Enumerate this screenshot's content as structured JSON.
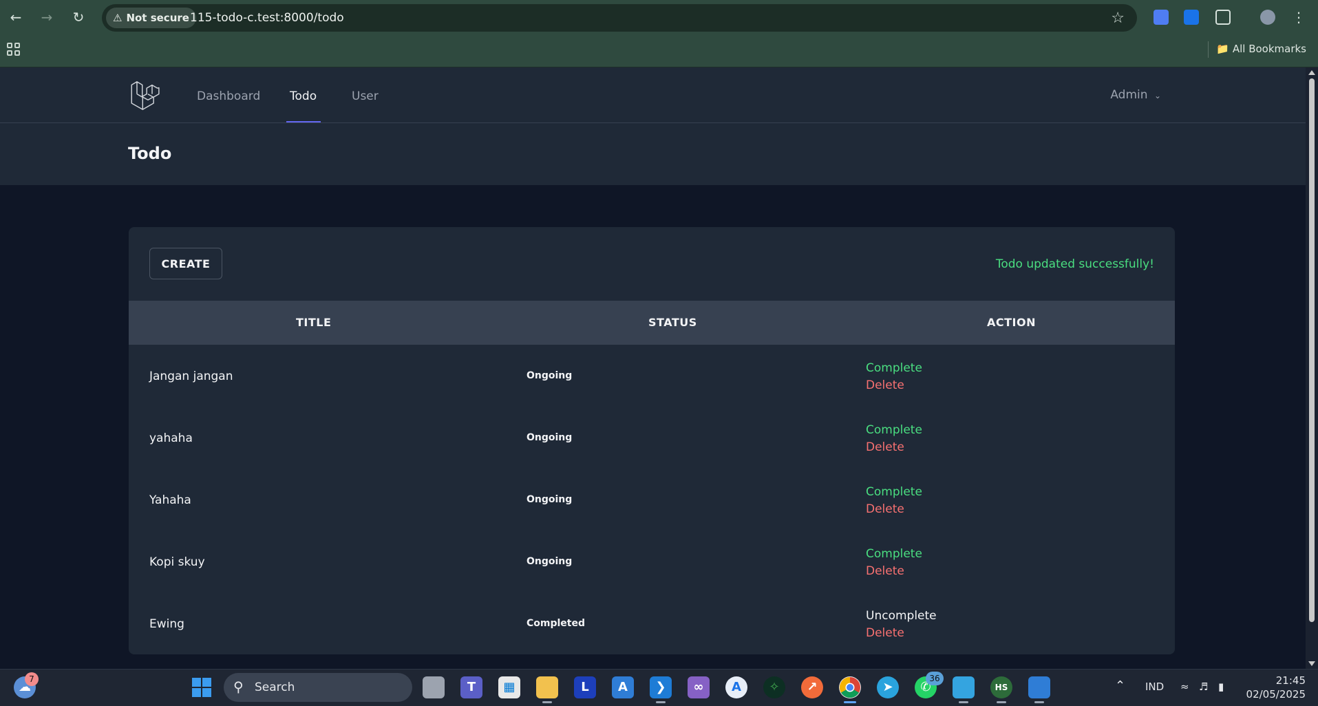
{
  "browser": {
    "not_secure_label": "Not secure",
    "url": "115-todo-c.test:8000/todo",
    "bookmarks_label": "All Bookmarks"
  },
  "app": {
    "nav": {
      "items": [
        {
          "label": "Dashboard",
          "active": false
        },
        {
          "label": "Todo",
          "active": true
        },
        {
          "label": "User",
          "active": false
        }
      ],
      "user_menu": "Admin"
    },
    "page_title": "Todo",
    "create_button": "CREATE",
    "flash_message": "Todo updated successfully!",
    "table": {
      "headers": [
        "TITLE",
        "STATUS",
        "ACTION"
      ],
      "rows": [
        {
          "title": "Jangan jangan",
          "status": "Ongoing",
          "toggle": "Complete",
          "delete": "Delete"
        },
        {
          "title": "yahaha",
          "status": "Ongoing",
          "toggle": "Complete",
          "delete": "Delete"
        },
        {
          "title": "Yahaha",
          "status": "Ongoing",
          "toggle": "Complete",
          "delete": "Delete"
        },
        {
          "title": "Kopi skuy",
          "status": "Ongoing",
          "toggle": "Complete",
          "delete": "Delete"
        },
        {
          "title": "Ewing",
          "status": "Completed",
          "toggle": "Uncomplete",
          "delete": "Delete"
        }
      ]
    }
  },
  "taskbar": {
    "search_label": "Search",
    "weather_badge": "7",
    "whatsapp_badge": "36",
    "language": "IND",
    "time": "21:45",
    "date": "02/05/2025"
  },
  "colors": {
    "accent": "#6366f1",
    "success": "#4ade80",
    "danger": "#f87171",
    "surface": "#1f2937",
    "background": "#0f1626"
  }
}
